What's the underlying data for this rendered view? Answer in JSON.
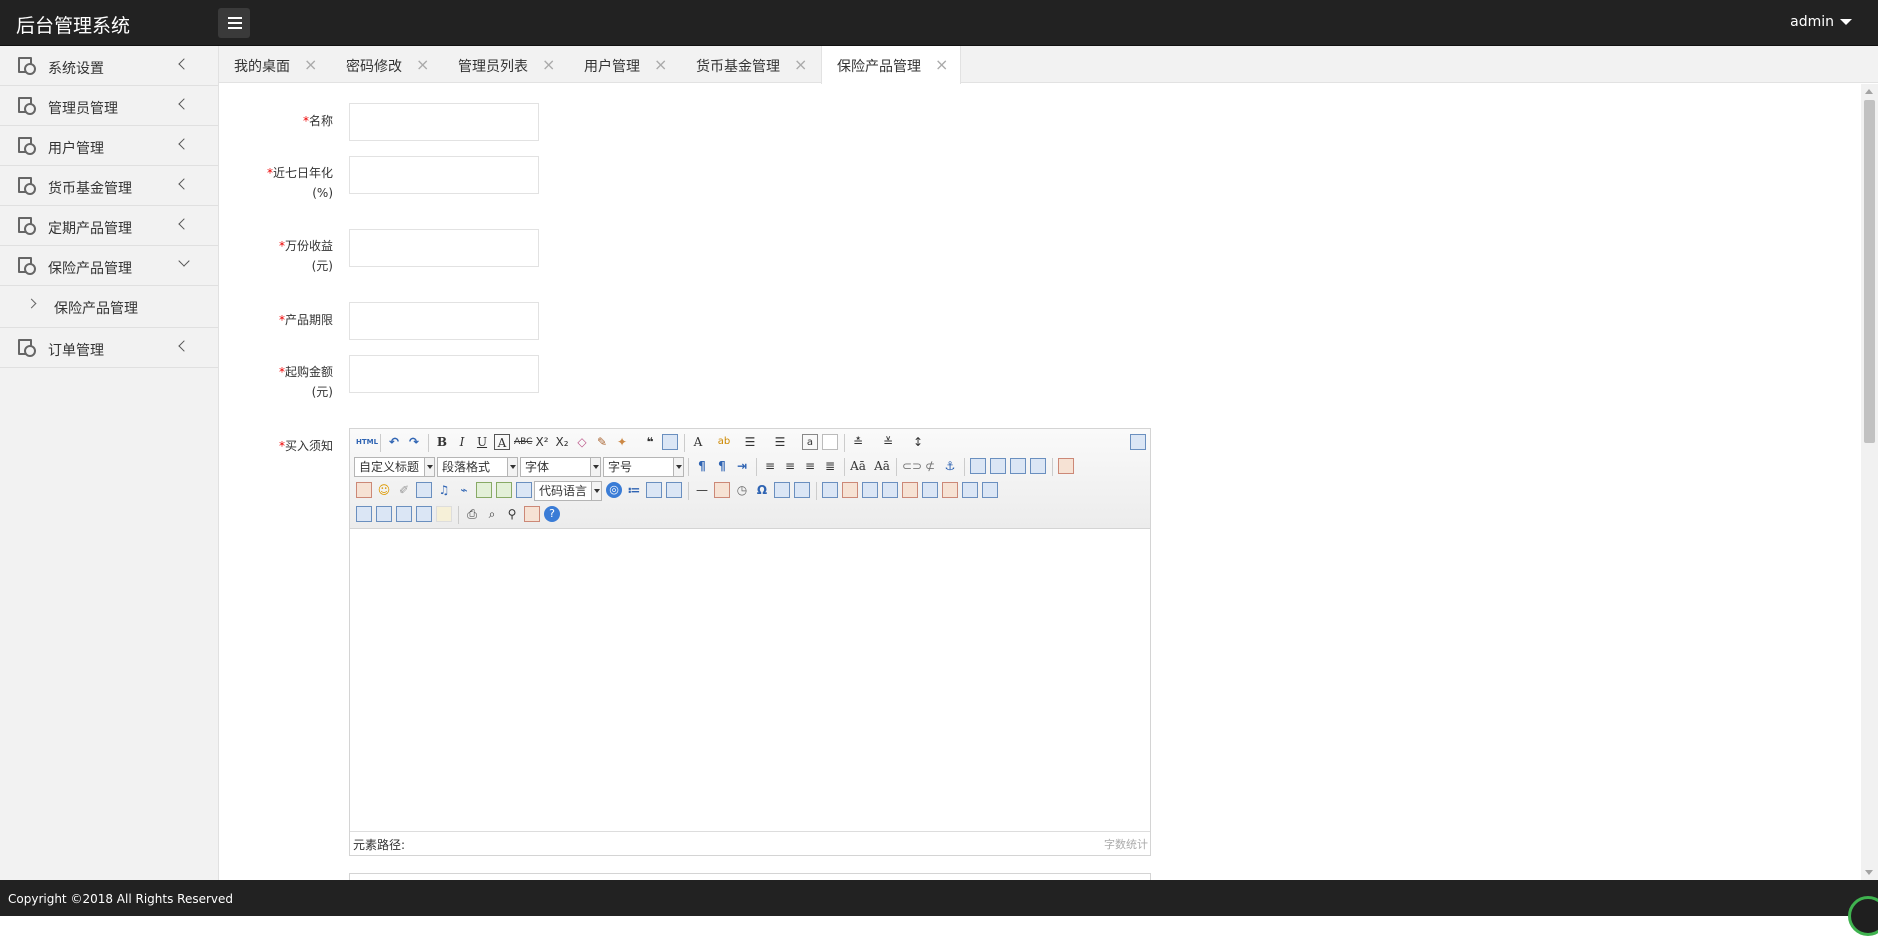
{
  "header": {
    "brand": "后台管理系统",
    "user": "admin"
  },
  "sidebar": {
    "items": [
      {
        "label": "系统设置"
      },
      {
        "label": "管理员管理"
      },
      {
        "label": "用户管理"
      },
      {
        "label": "货币基金管理"
      },
      {
        "label": "定期产品管理"
      },
      {
        "label": "保险产品管理",
        "expanded": true,
        "children": [
          {
            "label": "保险产品管理"
          }
        ]
      },
      {
        "label": "订单管理"
      }
    ]
  },
  "tabs": [
    {
      "label": "我的桌面"
    },
    {
      "label": "密码修改"
    },
    {
      "label": "管理员列表"
    },
    {
      "label": "用户管理"
    },
    {
      "label": "货币基金管理"
    },
    {
      "label": "保险产品管理",
      "active": true
    }
  ],
  "form": {
    "required_mark": "*",
    "fields": [
      {
        "label": "名称",
        "value": ""
      },
      {
        "label_line1": "近七日年化",
        "label_line2": "(%)",
        "value": ""
      },
      {
        "label_line1": "万份收益",
        "label_line2": "(元)",
        "value": ""
      },
      {
        "label": "产品期限",
        "value": ""
      },
      {
        "label_line1": "起购金额",
        "label_line2": "(元)",
        "value": ""
      }
    ],
    "editor": {
      "label": "买入须知",
      "toolbar": {
        "custom_title": "自定义标题",
        "paragraph": "段落格式",
        "font_family": "字体",
        "font_size": "字号",
        "code_language": "代码语言"
      },
      "path_label": "元素路径:",
      "word_count": "字数统计"
    }
  },
  "footer": {
    "copyright": "Copyright ©2018 All Rights Reserved"
  }
}
